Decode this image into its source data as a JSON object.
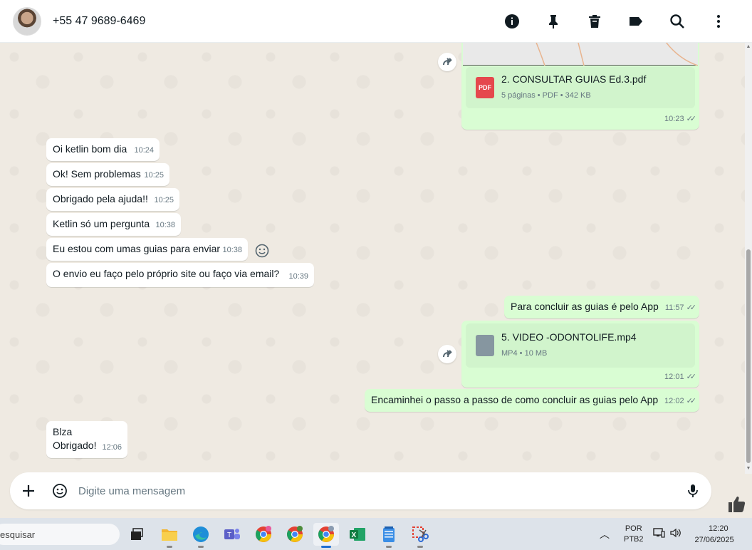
{
  "header": {
    "contact_name": "+55 47 9689-6469",
    "icons": [
      "info-icon",
      "pin-icon",
      "delete-icon",
      "label-icon",
      "search-icon",
      "menu-icon"
    ]
  },
  "messages": {
    "doc1": {
      "name": "2. CONSULTAR GUIAS Ed.3.pdf",
      "meta": "5 páginas • PDF • 342 KB",
      "badge": "PDF",
      "time": "10:23"
    },
    "in1": {
      "text": "Oi ketlin bom dia",
      "time": "10:24"
    },
    "in2": {
      "text": "Ok! Sem problemas",
      "time": "10:25"
    },
    "in3": {
      "text": "Obrigado pela ajuda!!",
      "time": "10:25"
    },
    "in4": {
      "text": "Ketlin só um pergunta",
      "time": "10:38"
    },
    "in5": {
      "text": "Eu estou com umas guias para enviar",
      "time": "10:38"
    },
    "in6": {
      "text": "O envio eu faço pelo próprio  site ou faço via email?",
      "time": "10:39"
    },
    "out1": {
      "text": "Para concluir as guias é pelo App",
      "time": "11:57"
    },
    "doc2": {
      "name": "5. VIDEO -ODONTOLIFE.mp4",
      "meta": "MP4 • 10 MB",
      "time": "12:01"
    },
    "out2": {
      "text": "Encaminhei o passo a passo de como concluir as guias pelo App",
      "time": "12:02"
    },
    "in7": {
      "text": "Blza\nObrigado!",
      "time": "12:06"
    }
  },
  "composer": {
    "placeholder": "Digite uma mensagem"
  },
  "taskbar": {
    "search_text": "esquisar",
    "lang_line1": "POR",
    "lang_line2": "PTB2",
    "time": "12:20",
    "date": "27/06/2025"
  },
  "colors": {
    "incoming": "#ffffff",
    "outgoing": "#d9fdd3",
    "background": "#efeae2",
    "pdf_red": "#e5484d",
    "file_gray": "#8696a0"
  }
}
